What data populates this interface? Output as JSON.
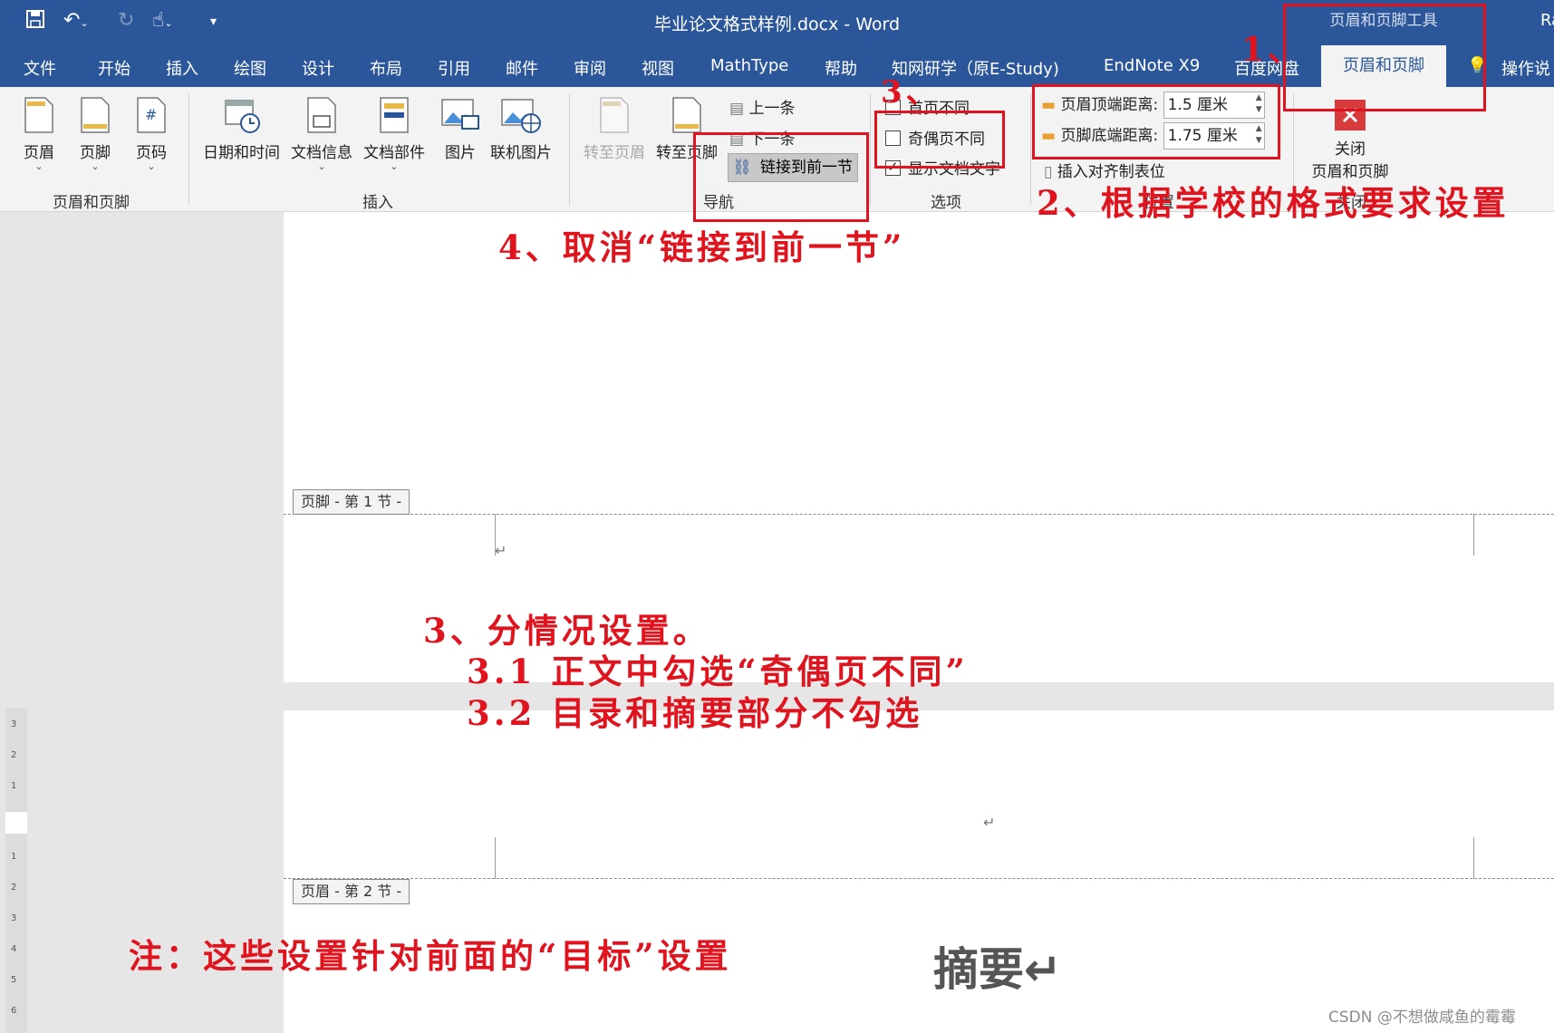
{
  "window": {
    "title": "毕业论文格式样例.docx  -  Word",
    "context_label": "页眉和页脚工具",
    "user_initial": "Ra"
  },
  "menu": {
    "tabs": [
      "文件",
      "开始",
      "插入",
      "绘图",
      "设计",
      "布局",
      "引用",
      "邮件",
      "审阅",
      "视图",
      "MathType",
      "帮助",
      "知网研学（原E-Study)",
      "EndNote X9",
      "百度网盘"
    ],
    "active_tab": "页眉和页脚",
    "tell_me": "操作说"
  },
  "ribbon": {
    "hf_group": {
      "label": "页眉和页脚",
      "header": "页眉",
      "footer": "页脚",
      "page_number": "页码"
    },
    "insert_group": {
      "label": "插入",
      "date_time": "日期和时间",
      "doc_info": "文档信息",
      "quick_parts": "文档部件",
      "picture": "图片",
      "online_picture": "联机图片"
    },
    "nav_group": {
      "label": "导航",
      "goto_header": "转至页眉",
      "goto_footer": "转至页脚",
      "previous": "上一条",
      "next": "下一条",
      "link_previous": "链接到前一节"
    },
    "options_group": {
      "label": "选项",
      "different_first": "首页不同",
      "different_odd_even": "奇偶页不同",
      "show_doc_text": "显示文档文字",
      "show_doc_text_checked": true,
      "odd_even_checked": false
    },
    "position_group": {
      "label": "位置",
      "header_from_top_label": "页眉顶端距离:",
      "header_from_top": "1.5 厘米",
      "footer_from_bottom_label": "页脚底端距离:",
      "footer_from_bottom": "1.75 厘米",
      "insert_align_tab": "插入对齐制表位"
    },
    "close_group": {
      "label": "关闭",
      "close_line1": "关闭",
      "close_line2": "页眉和页脚"
    }
  },
  "document": {
    "footer_tag": "页脚 - 第 1 节 -",
    "header_tag": "页眉 - 第 2 节 -",
    "abstract_heading": "摘要↵"
  },
  "annotations": {
    "n1": "1、",
    "n2": "2、根据学校的格式要求设置",
    "n3_top": "3、",
    "n4": "4、取消“链接到前一节”",
    "n3_title": "3、分情况设置。",
    "n3_1": "3.1  正文中勾选“奇偶页不同”",
    "n3_2": "3.2 目录和摘要部分不勾选",
    "note": "注：这些设置针对前面的“目标”设置"
  },
  "watermark": "CSDN @不想做咸鱼的霉霉",
  "colors": {
    "word_blue": "#2b579a",
    "annotation_red": "#e0141e",
    "close_red": "#d83b3b"
  }
}
